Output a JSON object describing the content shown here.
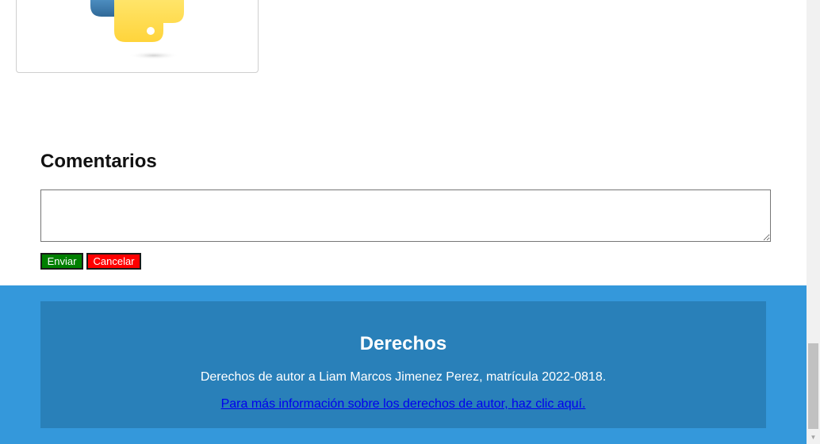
{
  "comments": {
    "title": "Comentarios",
    "textarea_value": "",
    "send_label": "Enviar",
    "cancel_label": "Cancelar"
  },
  "footer": {
    "title": "Derechos",
    "text": "Derechos de autor a Liam Marcos Jimenez Perez, matrícula 2022-0818.",
    "link_text": "Para más información sobre los derechos de autor, haz clic aquí."
  },
  "colors": {
    "send": "#008000",
    "cancel": "#ff0000",
    "footer_bg": "#3498db",
    "footer_inner": "#2980b9",
    "link": "#0000ee"
  },
  "icons": {
    "logo": "python-logo-icon",
    "scroll_down": "scroll-down-arrow-icon"
  }
}
